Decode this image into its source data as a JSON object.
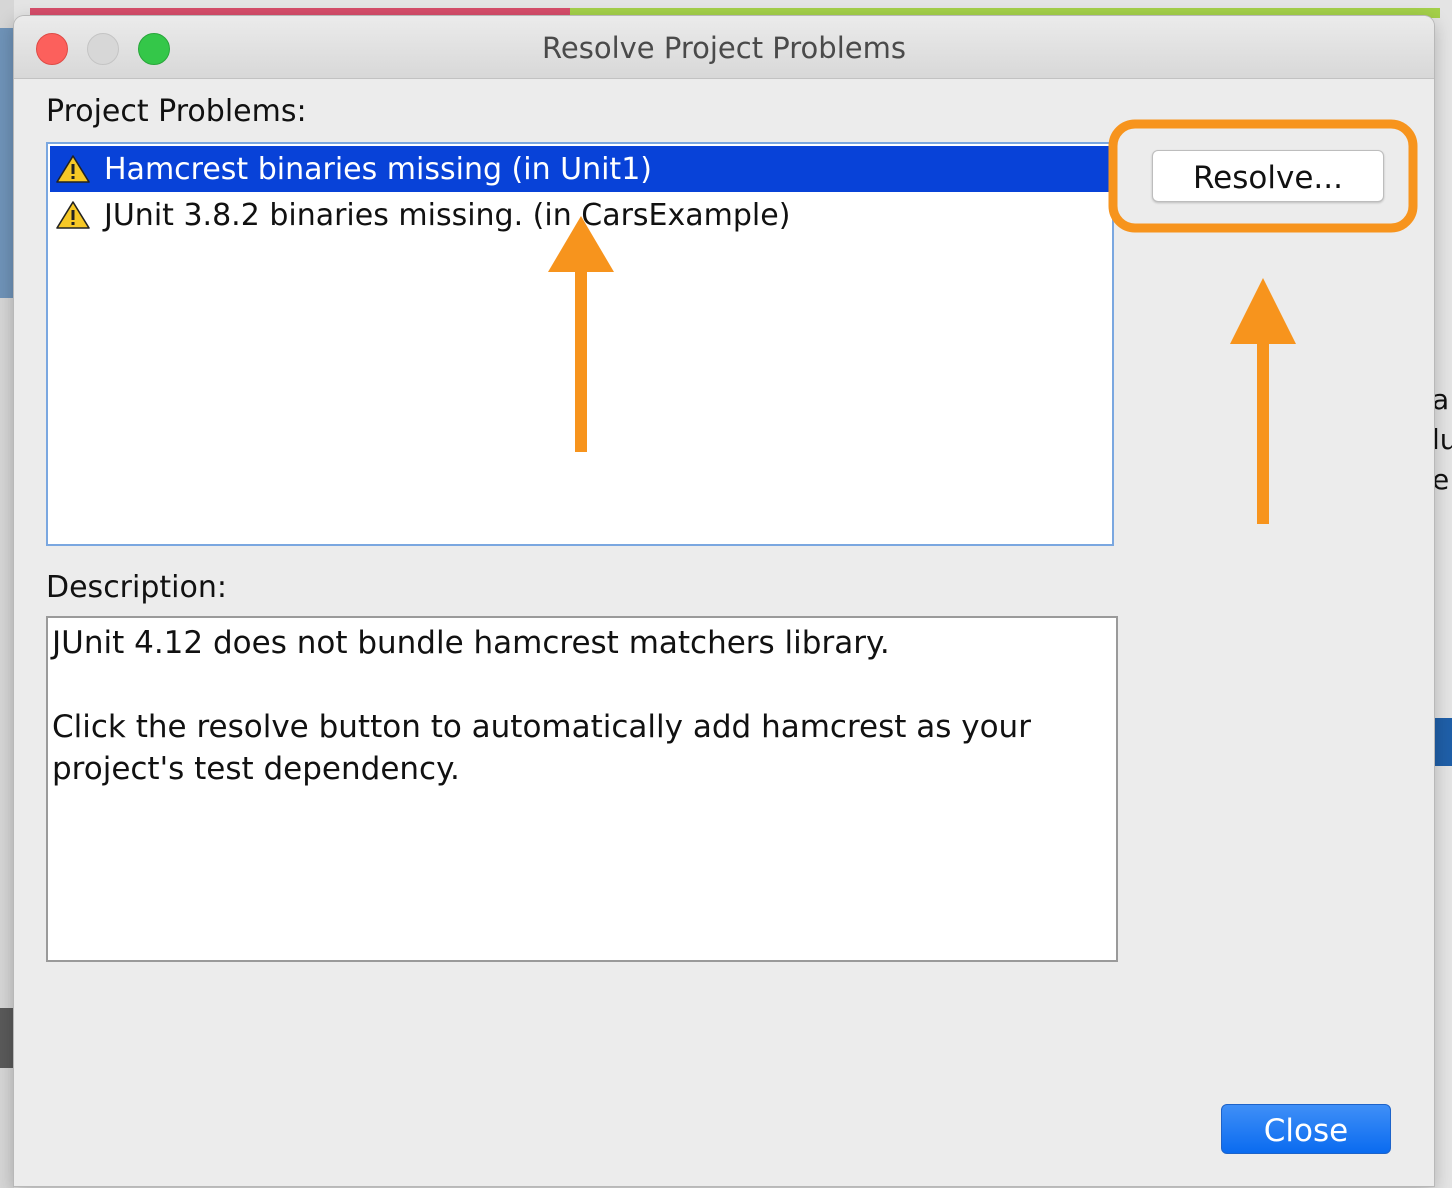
{
  "dialog": {
    "title": "Resolve Project Problems",
    "problems_label": "Project Problems:",
    "description_label": "Description:",
    "problems": [
      {
        "text": "Hamcrest binaries missing (in Unit1)",
        "icon": "warning-icon",
        "selected": true
      },
      {
        "text": "JUnit 3.8.2 binaries missing. (in CarsExample)",
        "icon": "warning-icon",
        "selected": false
      }
    ],
    "description": {
      "line1": "JUnit 4.12 does not bundle hamcrest matchers library.",
      "line2": "Click the resolve button to automatically add hamcrest as your project's test dependency."
    },
    "resolve_button": "Resolve...",
    "close_button": "Close"
  },
  "background": {
    "partial_text": [
      "a",
      "lu",
      "e"
    ]
  },
  "colors": {
    "selection": "#0842d8",
    "annotation": "#f7941d",
    "close_button": "#0a6bf0"
  }
}
